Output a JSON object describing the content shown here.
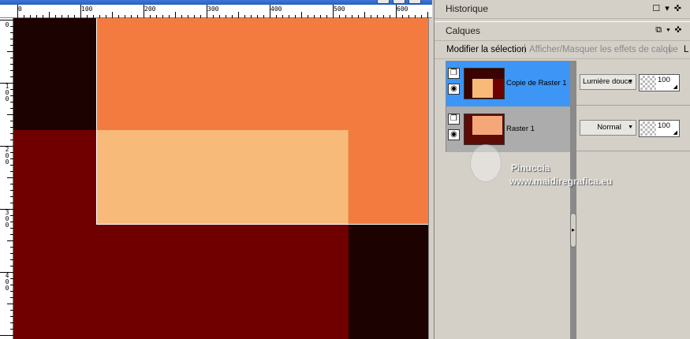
{
  "canvas": {
    "ruler_top_labels": [
      "0",
      "100",
      "200",
      "300",
      "400",
      "500",
      "600"
    ],
    "ruler_left_labels": [
      "0",
      "100",
      "200",
      "300",
      "400"
    ],
    "colors": {
      "dark_brown": "#1c0302",
      "dark_red": "#700000",
      "orange": "#f47b3f",
      "peach": "#f7ba79"
    }
  },
  "panels": {
    "history": {
      "title": "Historique"
    },
    "layers": {
      "title": "Calques",
      "toolbar": {
        "modify_selection": "Modifier la sélection",
        "separator": "|",
        "toggle_effects": "Afficher/Masquer les effets de calque",
        "more": "L"
      },
      "items": [
        {
          "name": "Copie de Raster 1",
          "blend_mode": "Lumière douce",
          "opacity": "100",
          "selected": true
        },
        {
          "name": "Raster 1",
          "blend_mode": "Normal",
          "opacity": "100",
          "selected": false
        }
      ]
    }
  },
  "watermark": {
    "name": "Pinuccia",
    "url": "www.maidiregrafica.eu"
  },
  "icons": [
    "restore-icon",
    "dropdown-arrow-icon",
    "pin-icon",
    "layer-link-icon",
    "eye-icon",
    "splitter-arrow-icon"
  ]
}
